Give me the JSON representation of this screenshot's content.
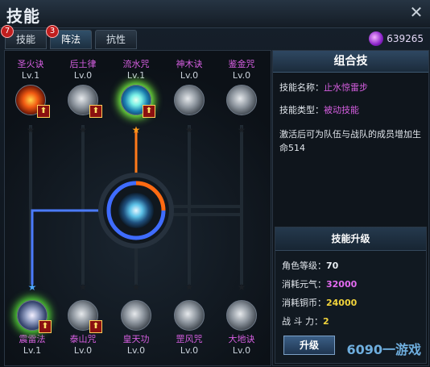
{
  "window": {
    "title": "技能"
  },
  "tabs": [
    {
      "label": "技能",
      "badge": "7"
    },
    {
      "label": "阵法",
      "badge": "3"
    },
    {
      "label": "抗性"
    }
  ],
  "currency": {
    "amount": "639265"
  },
  "skills_top": [
    {
      "name": "圣火诀",
      "level": "Lv.1",
      "icon": "fire-skill-icon",
      "upgradable": true,
      "star": "dark"
    },
    {
      "name": "后土律",
      "level": "Lv.0",
      "icon": "earth-skill-icon",
      "upgradable": true,
      "star": "dark"
    },
    {
      "name": "流水咒",
      "level": "Lv.1",
      "icon": "water-skill-icon",
      "upgradable": true,
      "star": "lit-orange"
    },
    {
      "name": "神木诀",
      "level": "Lv.0",
      "icon": "wood-skill-icon",
      "upgradable": false,
      "star": "dark"
    },
    {
      "name": "鉴金咒",
      "level": "Lv.0",
      "icon": "metal-skill-icon",
      "upgradable": false,
      "star": "dark"
    }
  ],
  "skills_bottom": [
    {
      "name": "震雷法",
      "level": "Lv.1",
      "icon": "thunder-skill-icon",
      "upgradable": true,
      "star": "lit-blue"
    },
    {
      "name": "泰山咒",
      "level": "Lv.0",
      "icon": "mountain-skill-icon",
      "upgradable": true,
      "star": "dark"
    },
    {
      "name": "皇天功",
      "level": "Lv.0",
      "icon": "heaven-skill-icon",
      "upgradable": false,
      "star": "dark"
    },
    {
      "name": "罡风咒",
      "level": "Lv.0",
      "icon": "wind-skill-icon",
      "upgradable": false,
      "star": "dark"
    },
    {
      "name": "大地诀",
      "level": "Lv.0",
      "icon": "ground-skill-icon",
      "upgradable": false,
      "star": "dark"
    }
  ],
  "center_skill": {
    "icon": "combo-orb-icon"
  },
  "combo_panel": {
    "header": "组合技",
    "name_label": "技能名称：",
    "name_value": "止水惊雷步",
    "type_label": "技能类型：",
    "type_value": "被动技能",
    "description": "激活后可为队伍与战队的成员增加生命514"
  },
  "upgrade_panel": {
    "header": "技能升级",
    "rows": [
      {
        "label": "角色等级：",
        "value": "70"
      },
      {
        "label": "消耗元气：",
        "value": "32000"
      },
      {
        "label": "消耗铜币：",
        "value": "24000"
      },
      {
        "label": "战 斗 力：",
        "value": "2"
      }
    ],
    "button": "升级"
  },
  "watermark": "6090一游戏",
  "colors": {
    "skill_name": "#d55ee0",
    "path_orange": "#ff7a1a",
    "path_blue": "#4b7bff",
    "star_orange": "#ff9a1a",
    "star_blue": "#4fa8ff"
  }
}
